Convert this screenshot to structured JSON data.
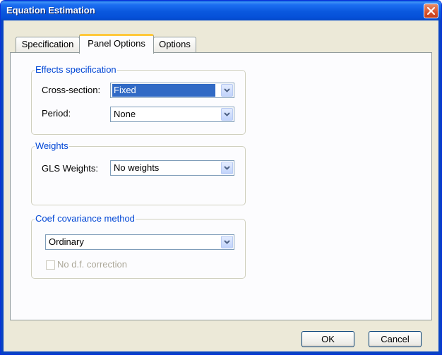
{
  "window": {
    "title": "Equation Estimation"
  },
  "tabs": [
    {
      "label": "Specification",
      "active": false
    },
    {
      "label": "Panel Options",
      "active": true
    },
    {
      "label": "Options",
      "active": false
    }
  ],
  "effects_spec": {
    "title": "Effects specification",
    "cross_section_label": "Cross-section:",
    "cross_section_value": "Fixed",
    "period_label": "Period:",
    "period_value": "None"
  },
  "weights": {
    "title": "Weights",
    "gls_label": "GLS Weights:",
    "gls_value": "No weights"
  },
  "coef_cov": {
    "title": "Coef covariance method",
    "method_value": "Ordinary",
    "df_correction_label": "No d.f. correction",
    "df_correction_checked": false
  },
  "buttons": {
    "ok": "OK",
    "cancel": "Cancel"
  },
  "icons": {
    "close": "close-icon",
    "dropdown": "chevron-down-icon"
  },
  "colors": {
    "titlebar": "#0a58de",
    "group_title": "#0046d5",
    "selection": "#316ac5"
  }
}
